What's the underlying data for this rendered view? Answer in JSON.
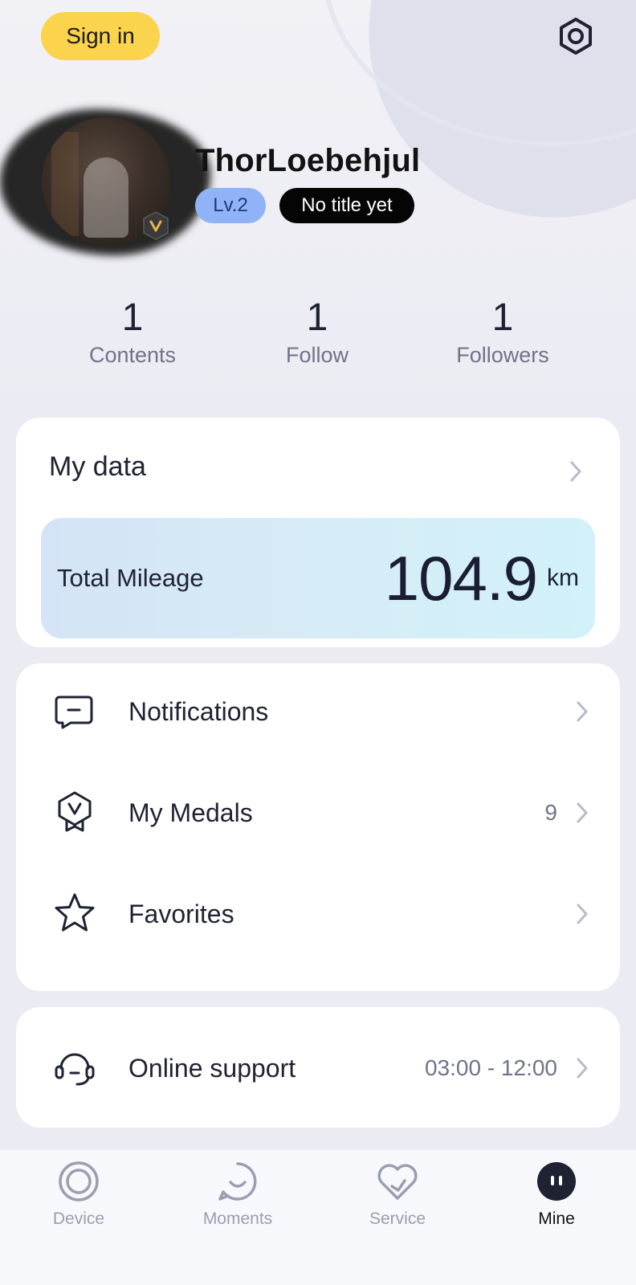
{
  "header": {
    "sign_in_label": "Sign in",
    "settings_icon": "settings-hex-icon"
  },
  "profile": {
    "username": "ThorLoebehjul",
    "level": "Lv.2",
    "title_badge": "No title yet",
    "avatar_badge": "V"
  },
  "stats": [
    {
      "value": "1",
      "label": "Contents"
    },
    {
      "value": "1",
      "label": "Follow"
    },
    {
      "value": "1",
      "label": "Followers"
    }
  ],
  "my_data": {
    "title": "My data",
    "mileage_label": "Total Mileage",
    "mileage_value": "104.9",
    "mileage_unit": "km"
  },
  "menu": [
    {
      "label": "Notifications",
      "icon": "message-icon",
      "value": ""
    },
    {
      "label": "My Medals",
      "icon": "medal-icon",
      "value": "9"
    },
    {
      "label": "Favorites",
      "icon": "star-icon",
      "value": ""
    }
  ],
  "support": {
    "label": "Online support",
    "icon": "headset-icon",
    "hours": "03:00 - 12:00"
  },
  "tabs": [
    {
      "label": "Device",
      "icon": "device-ring-icon",
      "active": false
    },
    {
      "label": "Moments",
      "icon": "moments-bubble-icon",
      "active": false
    },
    {
      "label": "Service",
      "icon": "service-heart-icon",
      "active": false
    },
    {
      "label": "Mine",
      "icon": "mine-face-icon",
      "active": true
    }
  ],
  "colors": {
    "sign_in_bg": "#fbd34d",
    "level_bg": "#8fb3f6",
    "title_badge_bg": "#050505",
    "accent_text": "#1e2233",
    "muted_text": "#6f7388",
    "page_bg": "#ebebf3"
  }
}
